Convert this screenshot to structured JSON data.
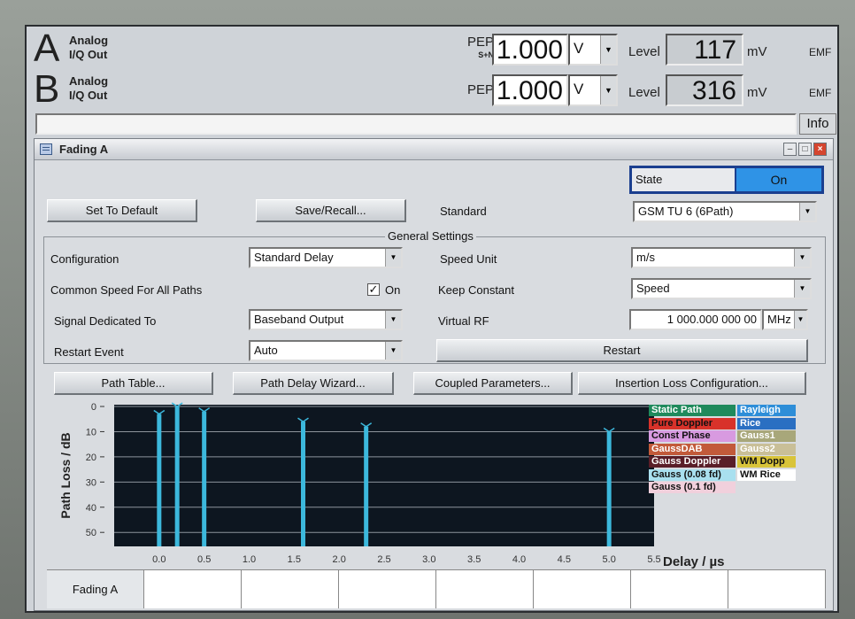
{
  "header": {
    "a": {
      "letter": "A",
      "label_line1": "Analog",
      "label_line2": "I/Q Out",
      "pep_label": "PEP",
      "pep_sub": "S+N",
      "pep_value": "1.000",
      "pep_unit": "V",
      "level_label": "Level",
      "level_value": "117",
      "level_unit": "mV",
      "emf": "EMF"
    },
    "b": {
      "letter": "B",
      "label_line1": "Analog",
      "label_line2": "I/Q Out",
      "pep_label": "PEP",
      "pep_value": "1.000",
      "pep_unit": "V",
      "level_label": "Level",
      "level_value": "316",
      "level_unit": "mV",
      "emf": "EMF"
    },
    "info_label": "Info"
  },
  "window": {
    "title": "Fading A",
    "state_label": "State",
    "state_value": "On",
    "set_default_label": "Set To Default",
    "save_recall_label": "Save/Recall...",
    "standard_label": "Standard",
    "standard_value": "GSM TU 6 (6Path)",
    "general_settings_title": "General Settings",
    "configuration_label": "Configuration",
    "configuration_value": "Standard Delay",
    "speed_unit_label": "Speed Unit",
    "speed_unit_value": "m/s",
    "common_speed_label": "Common Speed For All Paths",
    "common_speed_on": "On",
    "keep_constant_label": "Keep Constant",
    "keep_constant_value": "Speed",
    "signal_dedicated_label": "Signal Dedicated To",
    "signal_dedicated_value": "Baseband Output",
    "virtual_rf_label": "Virtual RF",
    "virtual_rf_value": "1 000.000 000 00",
    "virtual_rf_unit": "MHz",
    "restart_event_label": "Restart Event",
    "restart_event_value": "Auto",
    "restart_button": "Restart",
    "path_table_button": "Path Table...",
    "path_delay_wizard_button": "Path Delay Wizard...",
    "coupled_params_button": "Coupled Parameters...",
    "insertion_loss_button": "Insertion Loss Configuration...",
    "tabs": [
      "Fading A",
      "",
      "",
      "",
      "",
      "",
      "",
      ""
    ]
  },
  "legend": [
    {
      "label": "Static Path",
      "color": "#1f8a5c",
      "text": "#ffffff"
    },
    {
      "label": "Rayleigh",
      "color": "#2e8ed8",
      "text": "#ffffff"
    },
    {
      "label": "Pure Doppler",
      "color": "#d8322a",
      "text": "#111111"
    },
    {
      "label": "Rice",
      "color": "#2a6fc2",
      "text": "#ffffff"
    },
    {
      "label": "Const Phase",
      "color": "#d89ae0",
      "text": "#111111"
    },
    {
      "label": "Gauss1",
      "color": "#a8a77a",
      "text": "#ffffff"
    },
    {
      "label": "GaussDAB",
      "color": "#c25a3a",
      "text": "#ffffff"
    },
    {
      "label": "Gauss2",
      "color": "#c9bf98",
      "text": "#ffffff"
    },
    {
      "label": "Gauss Doppler",
      "color": "#5a1e28",
      "text": "#ffffff"
    },
    {
      "label": "WM Dopp",
      "color": "#d9c43a",
      "text": "#111111"
    },
    {
      "label": "Gauss (0.08 fd)",
      "color": "#a9e0ef",
      "text": "#111111"
    },
    {
      "label": "WM Rice",
      "color": "#ffffff",
      "text": "#111111"
    },
    {
      "label": "Gauss (0.1 fd)",
      "color": "#f1d0dc",
      "text": "#111111"
    }
  ],
  "chart_data": {
    "type": "bar",
    "xlabel": "Delay  / µs",
    "ylabel": "Path Loss / dB",
    "xlim": [
      -0.5,
      5.5
    ],
    "ylim": [
      0,
      60
    ],
    "xticks": [
      "0.0",
      "0.5",
      "1.0",
      "1.5",
      "2.0",
      "2.5",
      "3.0",
      "3.5",
      "4.0",
      "4.5",
      "5.0",
      "5.5"
    ],
    "yticks": [
      "0",
      "10",
      "20",
      "30",
      "40",
      "50"
    ],
    "series": [
      {
        "x": [
          0.0,
          0.2,
          0.5,
          1.6,
          2.3,
          5.0
        ],
        "values": [
          3,
          0,
          2,
          6,
          8,
          10
        ],
        "color": "#3cb8dc"
      }
    ]
  }
}
